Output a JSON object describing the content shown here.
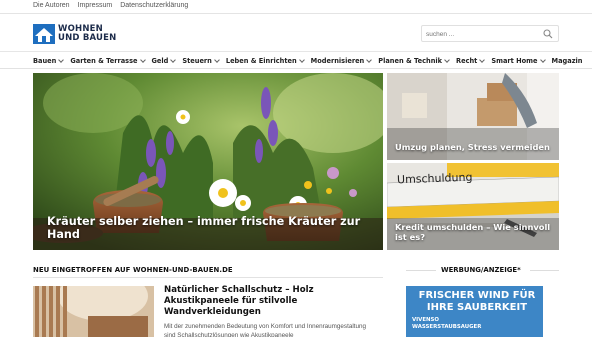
{
  "topbar": {
    "links": [
      "Die Autoren",
      "Impressum",
      "Datenschutzerklärung"
    ]
  },
  "logo": {
    "line1": "WOHNEN",
    "line2": "UND BAUEN"
  },
  "search": {
    "placeholder": "suchen ..."
  },
  "nav": {
    "items": [
      {
        "label": "Bauen",
        "has_dropdown": true
      },
      {
        "label": "Garten & Terrasse",
        "has_dropdown": true
      },
      {
        "label": "Geld",
        "has_dropdown": true
      },
      {
        "label": "Steuern",
        "has_dropdown": true
      },
      {
        "label": "Leben & Einrichten",
        "has_dropdown": true
      },
      {
        "label": "Modernisieren",
        "has_dropdown": true
      },
      {
        "label": "Planen & Technik",
        "has_dropdown": true
      },
      {
        "label": "Recht",
        "has_dropdown": true
      },
      {
        "label": "Smart Home",
        "has_dropdown": true
      },
      {
        "label": "Magazin",
        "has_dropdown": false
      }
    ]
  },
  "featured": {
    "main": {
      "title": "Kräuter selber ziehen – immer frische Kräuter zur Hand"
    },
    "side": [
      {
        "title": "Umzug planen, Stress vermeiden"
      },
      {
        "title": "Kredit umschulden – Wie sinnvoll ist es?",
        "image_text": "Umschuldung"
      }
    ]
  },
  "latest": {
    "heading": "NEU EINGETROFFEN AUF WOHNEN-UND-BAUEN.DE",
    "articles": [
      {
        "title": "Natürlicher Schallschutz – Holz Akustikpaneele für stilvolle Wandverkleidungen",
        "excerpt": "Mit der zunehmenden Bedeutung von Komfort und Innenraumgestaltung sind Schallschutzlösungen wie Akustikpaneele"
      }
    ]
  },
  "ad": {
    "heading": "WERBUNG/ANZEIGE*",
    "headline": "FRISCHER WIND FÜR IHRE SAUBERKEIT",
    "sub_line1": "VIVENSO",
    "sub_line2": "WASSERSTAUBSAUGER"
  },
  "colors": {
    "brand_blue": "#1e6ebf",
    "ad_blue": "#3d86c6",
    "text_dark": "#111111"
  }
}
